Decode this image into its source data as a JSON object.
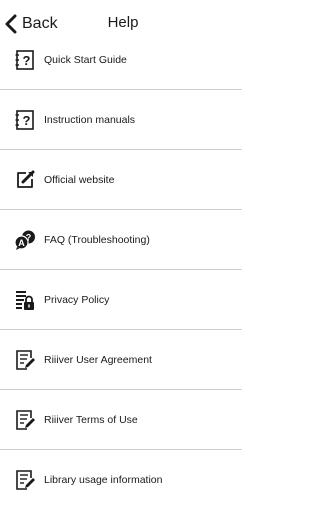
{
  "header": {
    "back_label": "Back",
    "title": "Help",
    "back_icon": "chevron-left-icon"
  },
  "menu": {
    "items": [
      {
        "label": "Quick Start Guide",
        "icon": "manual-book-icon"
      },
      {
        "label": "Instruction manuals",
        "icon": "manual-book-icon"
      },
      {
        "label": "Official website",
        "icon": "external-link-icon"
      },
      {
        "label": "FAQ (Troubleshooting)",
        "icon": "faq-chat-icon"
      },
      {
        "label": "Privacy Policy",
        "icon": "document-lock-icon"
      },
      {
        "label": "Riiiver User Agreement",
        "icon": "document-edit-icon"
      },
      {
        "label": "Riiiver Terms of Use",
        "icon": "document-edit-icon"
      },
      {
        "label": "Library usage information",
        "icon": "document-edit-icon"
      }
    ]
  },
  "colors": {
    "text": "#1a1a1a",
    "divider": "#cfcfcf",
    "background": "#ffffff"
  }
}
